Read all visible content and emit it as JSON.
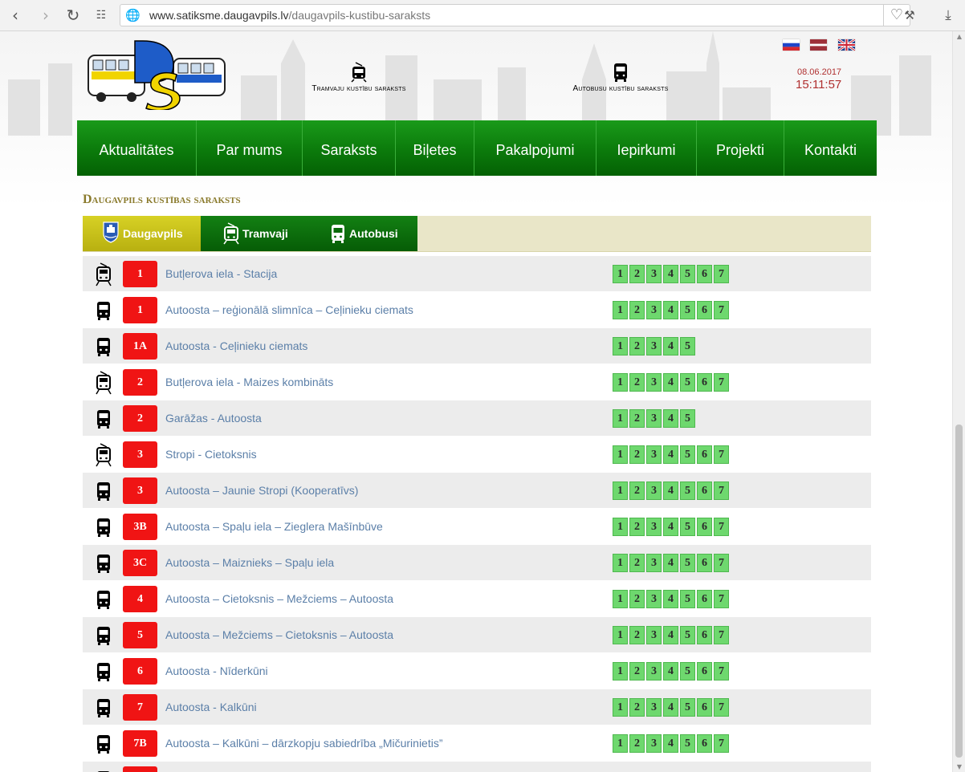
{
  "browser": {
    "url_domain": "www.satiksme.daugavpils.lv",
    "url_path": "/daugavpils-kustibu-saraksts"
  },
  "header": {
    "tram_link": "Tramvaju kustību saraksts",
    "bus_link": "Autobusu kustību saraksts",
    "date": "08.06.2017",
    "time": "15:11:57"
  },
  "menu": [
    "Aktualitātes",
    "Par mums",
    "Saraksts",
    "Biļetes",
    "Pakalpojumi",
    "Iepirkumi",
    "Projekti",
    "Kontakti"
  ],
  "section_title": "Daugavpils kustības saraksts",
  "tabs": {
    "daugavpils": "Daugavpils",
    "tram": "Tramvaji",
    "bus": "Autobusi"
  },
  "routes": [
    {
      "type": "tram",
      "number": "1",
      "name": "Butļerova iela - Stacija",
      "days": [
        "1",
        "2",
        "3",
        "4",
        "5",
        "6",
        "7"
      ]
    },
    {
      "type": "bus",
      "number": "1",
      "name": "Autoosta – reģionālā slimnīca – Ceļinieku ciemats",
      "days": [
        "1",
        "2",
        "3",
        "4",
        "5",
        "6",
        "7"
      ]
    },
    {
      "type": "bus",
      "number": "1A",
      "name": "Autoosta - Ceļinieku ciemats",
      "days": [
        "1",
        "2",
        "3",
        "4",
        "5"
      ]
    },
    {
      "type": "tram",
      "number": "2",
      "name": "Butļerova iela - Maizes kombināts",
      "days": [
        "1",
        "2",
        "3",
        "4",
        "5",
        "6",
        "7"
      ]
    },
    {
      "type": "bus",
      "number": "2",
      "name": "Garāžas - Autoosta",
      "days": [
        "1",
        "2",
        "3",
        "4",
        "5"
      ]
    },
    {
      "type": "tram",
      "number": "3",
      "name": "Stropi - Cietoksnis",
      "days": [
        "1",
        "2",
        "3",
        "4",
        "5",
        "6",
        "7"
      ]
    },
    {
      "type": "bus",
      "number": "3",
      "name": "Autoosta – Jaunie Stropi (Kooperatīvs)",
      "days": [
        "1",
        "2",
        "3",
        "4",
        "5",
        "6",
        "7"
      ]
    },
    {
      "type": "bus",
      "number": "3B",
      "name": "Autoosta – Spaļu iela – Zieglera Mašīnbūve",
      "days": [
        "1",
        "2",
        "3",
        "4",
        "5",
        "6",
        "7"
      ]
    },
    {
      "type": "bus",
      "number": "3C",
      "name": "Autoosta – Maiznieks – Spaļu iela",
      "days": [
        "1",
        "2",
        "3",
        "4",
        "5",
        "6",
        "7"
      ]
    },
    {
      "type": "bus",
      "number": "4",
      "name": "Autoosta – Cietoksnis – Mežciems – Autoosta",
      "days": [
        "1",
        "2",
        "3",
        "4",
        "5",
        "6",
        "7"
      ]
    },
    {
      "type": "bus",
      "number": "5",
      "name": "Autoosta – Mežciems – Cietoksnis – Autoosta",
      "days": [
        "1",
        "2",
        "3",
        "4",
        "5",
        "6",
        "7"
      ]
    },
    {
      "type": "bus",
      "number": "6",
      "name": "Autoosta - Nīderkūni",
      "days": [
        "1",
        "2",
        "3",
        "4",
        "5",
        "6",
        "7"
      ]
    },
    {
      "type": "bus",
      "number": "7",
      "name": "Autoosta - Kalkūni",
      "days": [
        "1",
        "2",
        "3",
        "4",
        "5",
        "6",
        "7"
      ]
    },
    {
      "type": "bus",
      "number": "7B",
      "name": "Autoosta – Kalkūni – dārzkopju sabiedrība „Mičurinietis”",
      "days": [
        "1",
        "2",
        "3",
        "4",
        "5",
        "6",
        "7"
      ]
    },
    {
      "type": "bus",
      "number": "",
      "name": "",
      "days": []
    }
  ],
  "colors": {
    "menu_green": "#0b7a0b",
    "route_number_red": "#f01414",
    "day_green": "#6ed86e",
    "tab_active": "#c9c21a",
    "tab_dark_green": "#0c6a0c",
    "title_olive": "#8a7a2c",
    "time_red": "#b03030"
  },
  "icons": {
    "tram": "tram-icon",
    "bus": "bus-icon",
    "coat_of_arms": "daugavpils-coat-of-arms-icon"
  }
}
